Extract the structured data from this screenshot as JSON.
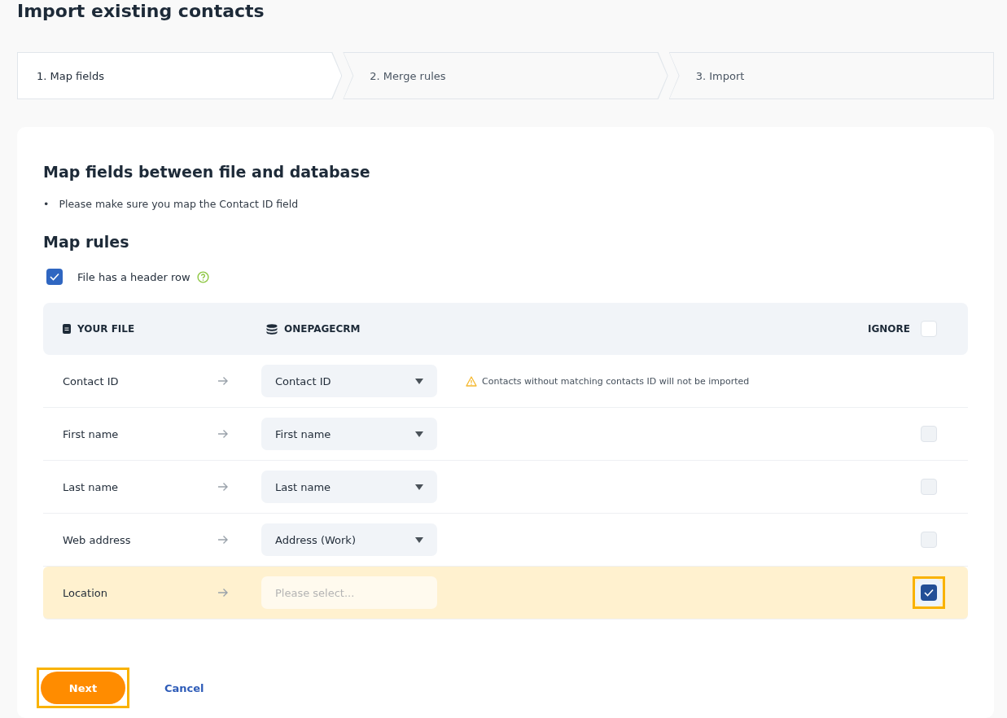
{
  "title": "Import existing contacts",
  "steps": [
    {
      "label": "1. Map fields",
      "selected": true
    },
    {
      "label": "2. Merge rules",
      "selected": false
    },
    {
      "label": "3. Import",
      "selected": false
    }
  ],
  "section_title": "Map fields between file and database",
  "notes": [
    {
      "bullet": "•",
      "text": "Please make sure you map the Contact ID field"
    }
  ],
  "rules_title": "Map rules",
  "header_row": {
    "label": "File has a header row",
    "checked": true
  },
  "table": {
    "your_file": "YOUR FILE",
    "crm_bold": "ONEPAGE",
    "crm_rest": "CRM",
    "ignore": "IGNORE",
    "ignore_all": false,
    "rows": [
      {
        "field": "Contact ID",
        "value": "Contact ID",
        "warning": "Contacts without matching contacts ID will not be imported"
      },
      {
        "field": "First name",
        "value": "First name",
        "ignored": false
      },
      {
        "field": "Last name",
        "value": "Last name",
        "ignored": false
      },
      {
        "field": "Web address",
        "value": "Address (Work)",
        "ignored": false
      },
      {
        "field": "Location",
        "placeholder": "Please select...",
        "ignored": true,
        "focused": true
      }
    ]
  },
  "buttons": {
    "next": {
      "label": "Next",
      "focused": true
    },
    "cancel": "Cancel"
  }
}
